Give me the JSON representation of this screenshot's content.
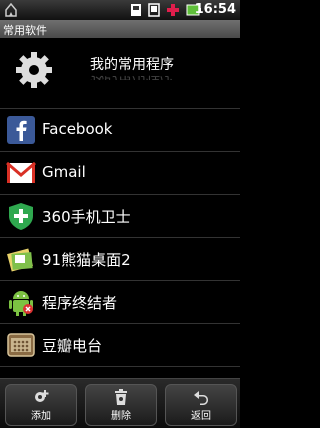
{
  "status": {
    "time": "16:54"
  },
  "titlebar": {
    "title": "常用软件"
  },
  "header": {
    "title": "我的常用程序"
  },
  "apps": [
    {
      "label": "Facebook",
      "icon": "facebook-icon"
    },
    {
      "label": "Gmail",
      "icon": "gmail-icon"
    },
    {
      "label": "360手机卫士",
      "icon": "shield-icon"
    },
    {
      "label": "91熊猫桌面2",
      "icon": "desktop-icon"
    },
    {
      "label": "程序终结者",
      "icon": "android-icon"
    },
    {
      "label": "豆瓣电台",
      "icon": "radio-icon"
    }
  ],
  "buttons": {
    "add": "添加",
    "delete": "删除",
    "back": "返回"
  },
  "colors": {
    "background": "#000000",
    "facebook": "#3b5998",
    "shield": "#2fa84f",
    "android": "#7cc242"
  }
}
